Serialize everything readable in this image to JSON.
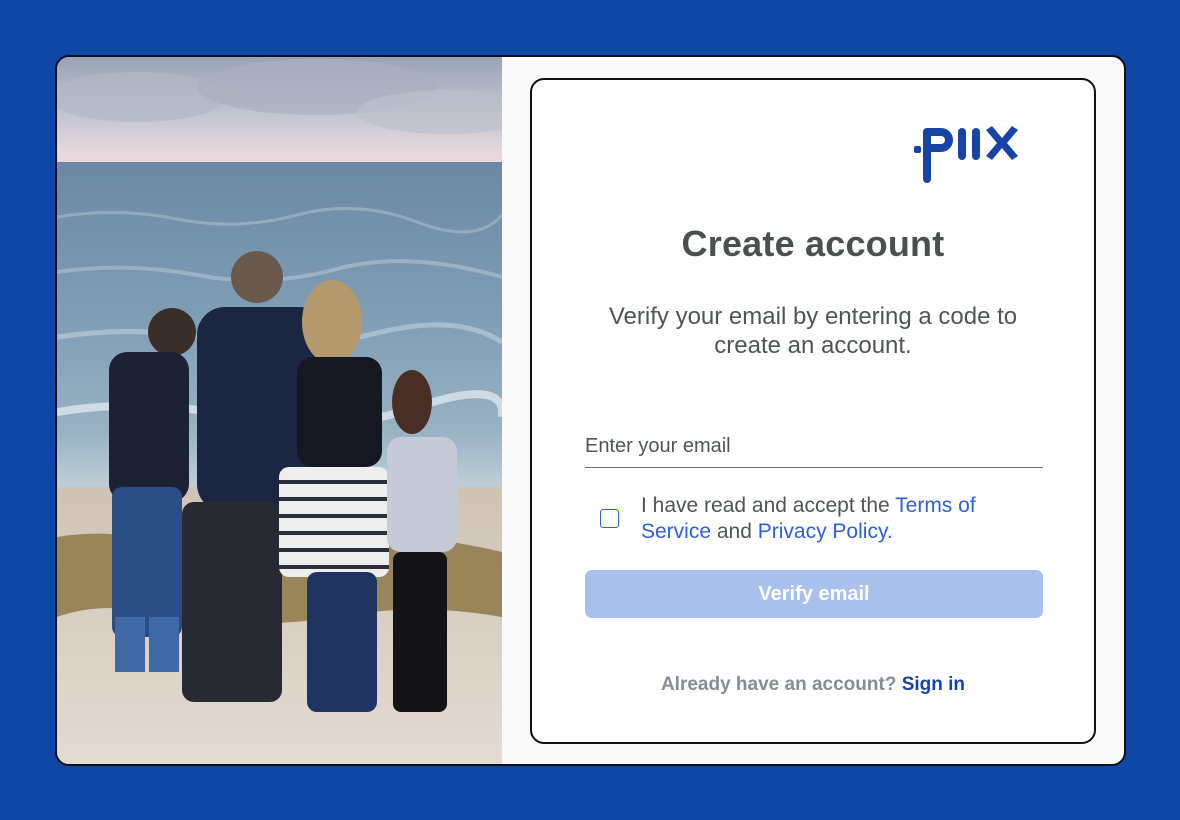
{
  "colors": {
    "page_background": "#0f47a6",
    "brand": "#1844a8",
    "link": "#2e5fdc",
    "button_disabled": "#a9c0ec",
    "heading": "#4a5050"
  },
  "photo": {
    "alt": "Family of four standing on a beach looking at the ocean"
  },
  "brand": {
    "logo_text": "piix",
    "logo_icon": "piix-logo"
  },
  "form": {
    "title": "Create account",
    "subtitle": "Verify your email by entering a code to create an account.",
    "email_placeholder": "Enter your email",
    "email_value": "",
    "consent": {
      "checked": false,
      "text_prefix": "I have read and accept the ",
      "terms_link": "Terms of Service",
      "text_middle": " and ",
      "privacy_link": "Privacy Policy",
      "text_suffix": "."
    },
    "verify_button": "Verify email",
    "footer_prompt": "Already have an account?",
    "sign_in_link": "Sign in"
  }
}
